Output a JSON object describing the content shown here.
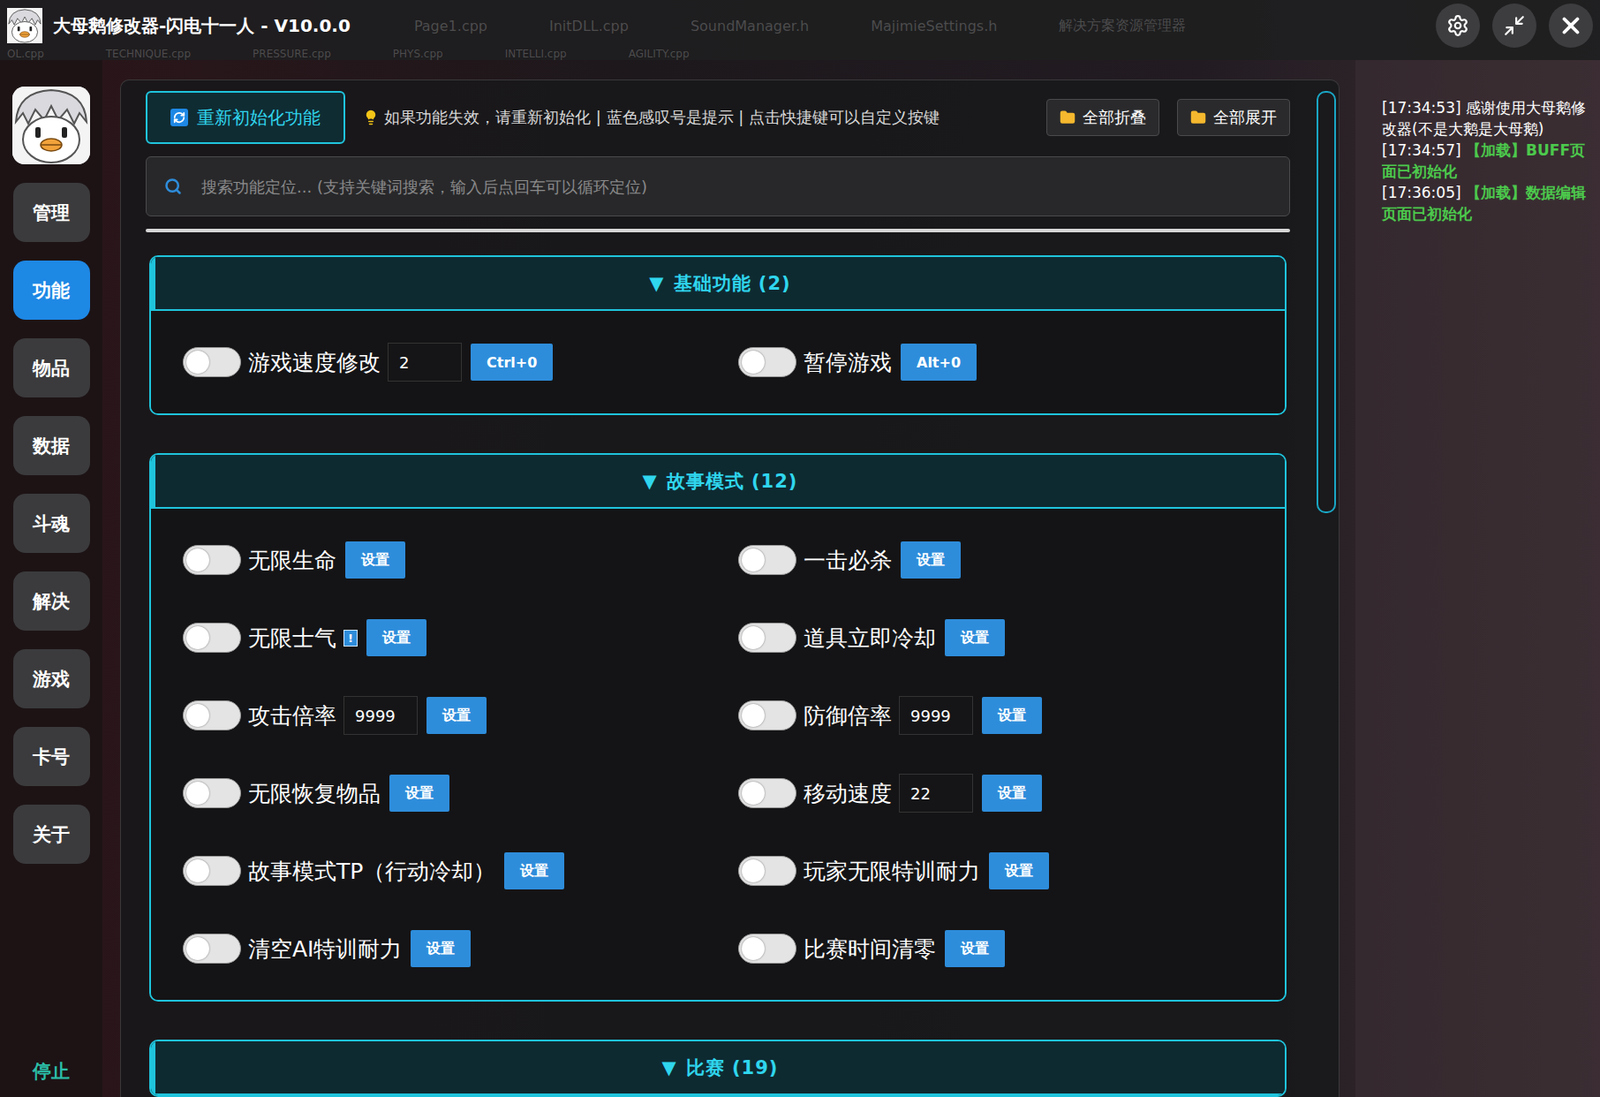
{
  "window": {
    "title": "大母鹅修改器-闪电十一人 - V10.0.0"
  },
  "ghost_tabs": {
    "row1": [
      "Page1.cpp",
      "InitDLL.cpp",
      "SoundManager.h",
      "MajimieSettings.h",
      "解决方案资源管理器"
    ],
    "row2": [
      "OL.cpp",
      "TECHNIQUE.cpp",
      "PRESSURE.cpp",
      "PHYS.cpp",
      "INTELLI.cpp",
      "AGILITY.cpp"
    ]
  },
  "sidebar": {
    "items": [
      {
        "label": "管理",
        "selected": false
      },
      {
        "label": "功能",
        "selected": true
      },
      {
        "label": "物品",
        "selected": false
      },
      {
        "label": "数据",
        "selected": false
      },
      {
        "label": "斗魂",
        "selected": false
      },
      {
        "label": "解决",
        "selected": false
      },
      {
        "label": "游戏",
        "selected": false
      },
      {
        "label": "卡号",
        "selected": false
      },
      {
        "label": "关于",
        "selected": false
      }
    ],
    "stop": "停止"
  },
  "toolbar": {
    "reinit": "重新初始化功能",
    "hint": "如果功能失效，请重新初始化 | 蓝色感叹号是提示 | 点击快捷键可以自定义按键",
    "collapse_all": "全部折叠",
    "expand_all": "全部展开"
  },
  "search": {
    "placeholder": "搜索功能定位... (支持关键词搜索，输入后点回车可以循环定位)"
  },
  "scrollbar": {
    "level": 0.42
  },
  "sections": [
    {
      "arrow": "▼",
      "title": "基础功能 (2)",
      "expanded": true,
      "items": [
        {
          "kind": "toggle-value",
          "label": "游戏速度修改",
          "on": false,
          "value": "2",
          "button": "Ctrl+0"
        },
        {
          "kind": "toggle",
          "label": "暂停游戏",
          "on": false,
          "button": "Alt+0"
        }
      ]
    },
    {
      "arrow": "▼",
      "title": "故事模式 (12)",
      "expanded": true,
      "items": [
        {
          "kind": "toggle",
          "label": "无限生命",
          "on": false,
          "button": "设置"
        },
        {
          "kind": "toggle",
          "label": "一击必杀",
          "on": false,
          "button": "设置"
        },
        {
          "kind": "toggle",
          "label": "无限士气",
          "on": false,
          "hint": "!",
          "button": "设置"
        },
        {
          "kind": "toggle",
          "label": "道具立即冷却",
          "on": false,
          "button": "设置"
        },
        {
          "kind": "toggle-value",
          "label": "攻击倍率",
          "on": false,
          "value": "9999",
          "button": "设置"
        },
        {
          "kind": "toggle-value",
          "label": "防御倍率",
          "on": false,
          "value": "9999",
          "button": "设置"
        },
        {
          "kind": "toggle",
          "label": "无限恢复物品",
          "on": false,
          "button": "设置"
        },
        {
          "kind": "toggle-value",
          "label": "移动速度",
          "on": false,
          "value": "22",
          "button": "设置"
        },
        {
          "kind": "toggle",
          "label": "故事模式TP（行动冷却）",
          "on": false,
          "button": "设置"
        },
        {
          "kind": "toggle",
          "label": "玩家无限特训耐力",
          "on": false,
          "button": "设置"
        },
        {
          "kind": "toggle",
          "label": "清空AI特训耐力",
          "on": false,
          "button": "设置"
        },
        {
          "kind": "toggle",
          "label": "比赛时间清零",
          "on": false,
          "button": "设置"
        }
      ]
    },
    {
      "arrow": "▼",
      "title": "比赛 (19)",
      "expanded": true,
      "items": []
    }
  ],
  "log": [
    {
      "time": "[17:34:53]",
      "text": "感谢使用大母鹅修改器(不是大鹅是大母鹅)",
      "color": "#ffffff"
    },
    {
      "time": "[17:34:57]",
      "text": "【加载】BUFF页面已初始化",
      "color": "#4cc94c"
    },
    {
      "time": "[17:36:05]",
      "text": "【加载】数据编辑页面已初始化",
      "color": "#4cc94c"
    }
  ]
}
